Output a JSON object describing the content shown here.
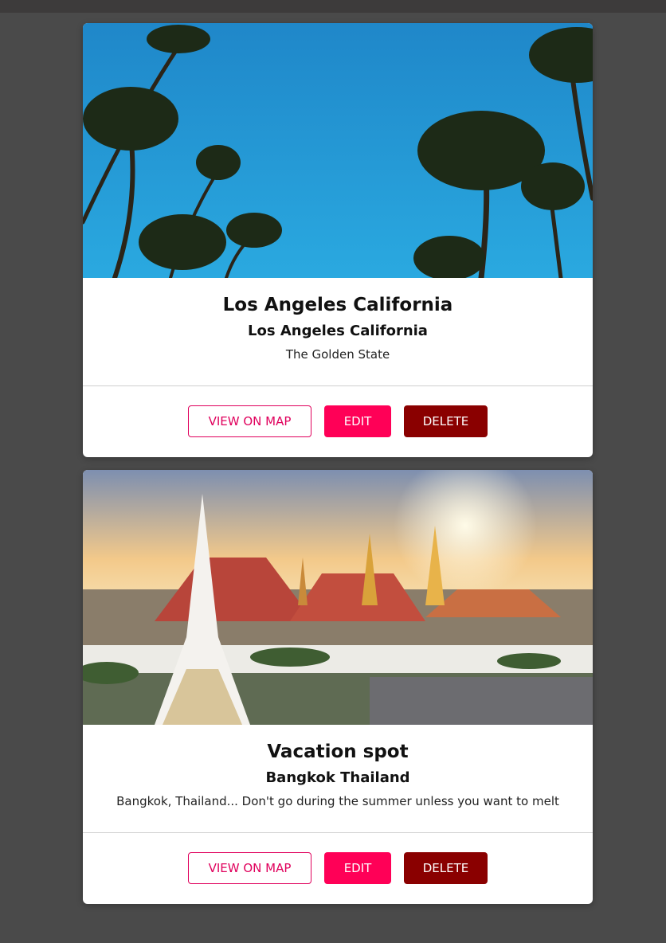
{
  "colors": {
    "page_background": "#4a4a4a",
    "accent": "#ff0057",
    "danger": "#8a0000"
  },
  "places": [
    {
      "image_alt": "Palm trees under a blue sky",
      "title": "Los Angeles California",
      "subtitle": "Los Angeles California",
      "description": "The Golden State",
      "actions": {
        "view_on_map": "VIEW ON MAP",
        "edit": "EDIT",
        "delete": "DELETE"
      }
    },
    {
      "image_alt": "Grand Palace temple complex at sunset",
      "title": "Vacation spot",
      "subtitle": "Bangkok Thailand",
      "description": "Bangkok, Thailand... Don't go during the summer unless you want to melt",
      "actions": {
        "view_on_map": "VIEW ON MAP",
        "edit": "EDIT",
        "delete": "DELETE"
      }
    }
  ]
}
